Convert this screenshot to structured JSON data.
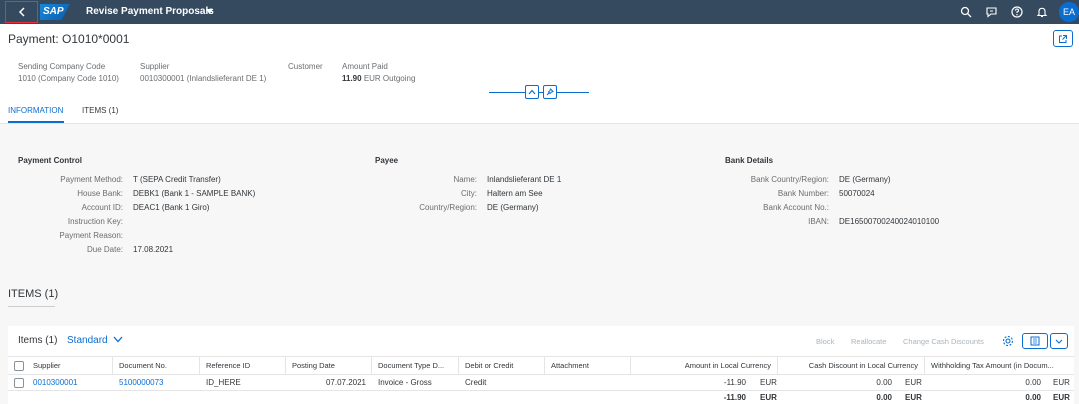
{
  "shell": {
    "logo": "SAP",
    "app_title": "Revise Payment Proposals",
    "avatar_initials": "EA"
  },
  "header": {
    "title": "Payment: O1010*0001",
    "attributes": [
      {
        "label": "Sending Company Code",
        "value": "1010 (Company Code 1010)"
      },
      {
        "label": "Supplier",
        "value": "0010300001 (Inlandslieferant DE 1)"
      },
      {
        "label": "Customer",
        "value": ""
      },
      {
        "label": "Amount Paid",
        "value_bold": "11.90",
        "value_rest": "EUR Outgoing"
      }
    ]
  },
  "tabs": [
    {
      "label": "INFORMATION",
      "active": true
    },
    {
      "label": "ITEMS (1)",
      "active": false
    }
  ],
  "payment_control": {
    "title": "Payment Control",
    "fields": [
      {
        "label": "Payment Method:",
        "value": "T (SEPA Credit Transfer)"
      },
      {
        "label": "House Bank:",
        "value": "DEBK1 (Bank 1 - SAMPLE BANK)"
      },
      {
        "label": "Account ID:",
        "value": "DEAC1 (Bank 1 Giro)"
      },
      {
        "label": "Instruction Key:",
        "value": ""
      },
      {
        "label": "Payment Reason:",
        "value": ""
      },
      {
        "label": "Due Date:",
        "value": "17.08.2021"
      }
    ]
  },
  "payee": {
    "title": "Payee",
    "fields": [
      {
        "label": "Name:",
        "value": "Inlandslieferant DE 1"
      },
      {
        "label": "City:",
        "value": "Haltern am See"
      },
      {
        "label": "Country/Region:",
        "value": "DE (Germany)"
      }
    ]
  },
  "bank_details": {
    "title": "Bank Details",
    "fields": [
      {
        "label": "Bank Country/Region:",
        "value": "DE (Germany)"
      },
      {
        "label": "Bank Number:",
        "value": "50070024"
      },
      {
        "label": "Bank Account No.:",
        "value": ""
      },
      {
        "label": "IBAN:",
        "value": "DE16500700240024010100"
      }
    ]
  },
  "items_section": {
    "heading": "ITEMS (1)",
    "table_title": "Items (1)",
    "variant": "Standard",
    "actions": [
      "Block",
      "Reallocate",
      "Change Cash Discounts"
    ],
    "columns": [
      "Supplier",
      "Document No.",
      "Reference ID",
      "Posting Date",
      "Document Type D...",
      "Debit or Credit",
      "Attachment",
      "Amount in Local Currency",
      "Cash Discount in Local Currency",
      "Withholding Tax Amount (in Docum..."
    ],
    "rows": [
      {
        "supplier": "0010300001",
        "document_no": "5100000073",
        "reference_id": "ID_HERE",
        "posting_date": "07.07.2021",
        "document_type": "Invoice - Gross",
        "debit_credit": "Credit",
        "attachment": "",
        "amount": "-11.90",
        "amount_cur": "EUR",
        "cash_discount": "0.00",
        "cash_discount_cur": "EUR",
        "withholding": "0.00",
        "withholding_cur": "EUR"
      }
    ],
    "totals": {
      "amount": "-11.90",
      "amount_cur": "EUR",
      "cash_discount": "0.00",
      "cash_discount_cur": "EUR",
      "withholding": "0.00",
      "withholding_cur": "EUR"
    }
  },
  "colors": {
    "shell": "#354a5f",
    "accent": "#0a6ed1",
    "highlight": "#e3303d"
  }
}
